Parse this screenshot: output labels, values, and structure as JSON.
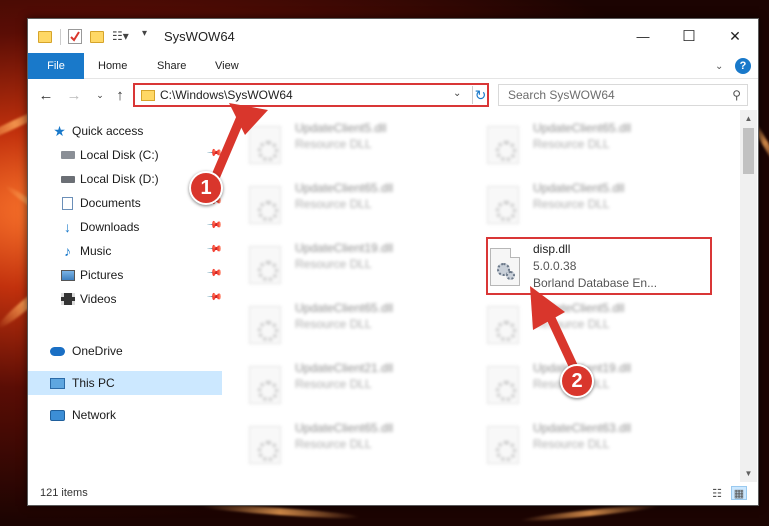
{
  "window": {
    "title": "SysWOW64",
    "minimize_glyph": "—",
    "maximize_glyph": "☐",
    "close_glyph": "✕"
  },
  "ribbon": {
    "file_tab": "File",
    "tabs": [
      "Home",
      "Share",
      "View"
    ],
    "help_glyph": "?"
  },
  "nav": {
    "address": "C:\\Windows\\SysWOW64",
    "search_placeholder": "Search SysWOW64"
  },
  "sidebar": {
    "items": [
      {
        "label": "Quick access",
        "icon": "star-icon"
      },
      {
        "label": "Local Disk (C:)",
        "icon": "drive-icon"
      },
      {
        "label": "Local Disk (D:)",
        "icon": "drive-icon"
      },
      {
        "label": "Documents",
        "icon": "document-icon"
      },
      {
        "label": "Downloads",
        "icon": "download-icon"
      },
      {
        "label": "Music",
        "icon": "music-icon"
      },
      {
        "label": "Pictures",
        "icon": "picture-icon"
      },
      {
        "label": "Videos",
        "icon": "video-icon"
      },
      {
        "label": "OneDrive",
        "icon": "cloud-icon"
      },
      {
        "label": "This PC",
        "icon": "computer-icon"
      },
      {
        "label": "Network",
        "icon": "network-icon"
      }
    ]
  },
  "files": [
    {
      "name": "UpdateClient5.dll",
      "desc": "Resource DLL"
    },
    {
      "name": "UpdateClient65.dll",
      "desc": "Resource DLL"
    },
    {
      "name": "UpdateClient65.dll",
      "desc": "Resource DLL"
    },
    {
      "name": "UpdateClient5.dll",
      "desc": "Resource DLL"
    },
    {
      "name": "UpdateClient19.dll",
      "desc": "Resource DLL"
    },
    {
      "name": "UpdateClient65.dll",
      "desc": "Resource DLL"
    },
    {
      "name": "UpdateClient5.dll",
      "desc": "Resource DLL"
    },
    {
      "name": "UpdateClient21.dll",
      "desc": "Resource DLL"
    },
    {
      "name": "UpdateClient19.dll",
      "desc": "Resource DLL"
    },
    {
      "name": "UpdateClient65.dll",
      "desc": "Resource DLL"
    },
    {
      "name": "UpdateClient63.dll",
      "desc": "Resource DLL"
    }
  ],
  "highlighted_file": {
    "name": "disp.dll",
    "version": "5.0.0.38",
    "company": "Borland Database En..."
  },
  "status": {
    "item_count": "121 items"
  },
  "markers": {
    "first": "1",
    "second": "2"
  },
  "colors": {
    "accent": "#1979ca",
    "highlight_red": "#d93636",
    "marker_red": "#d9362c"
  }
}
